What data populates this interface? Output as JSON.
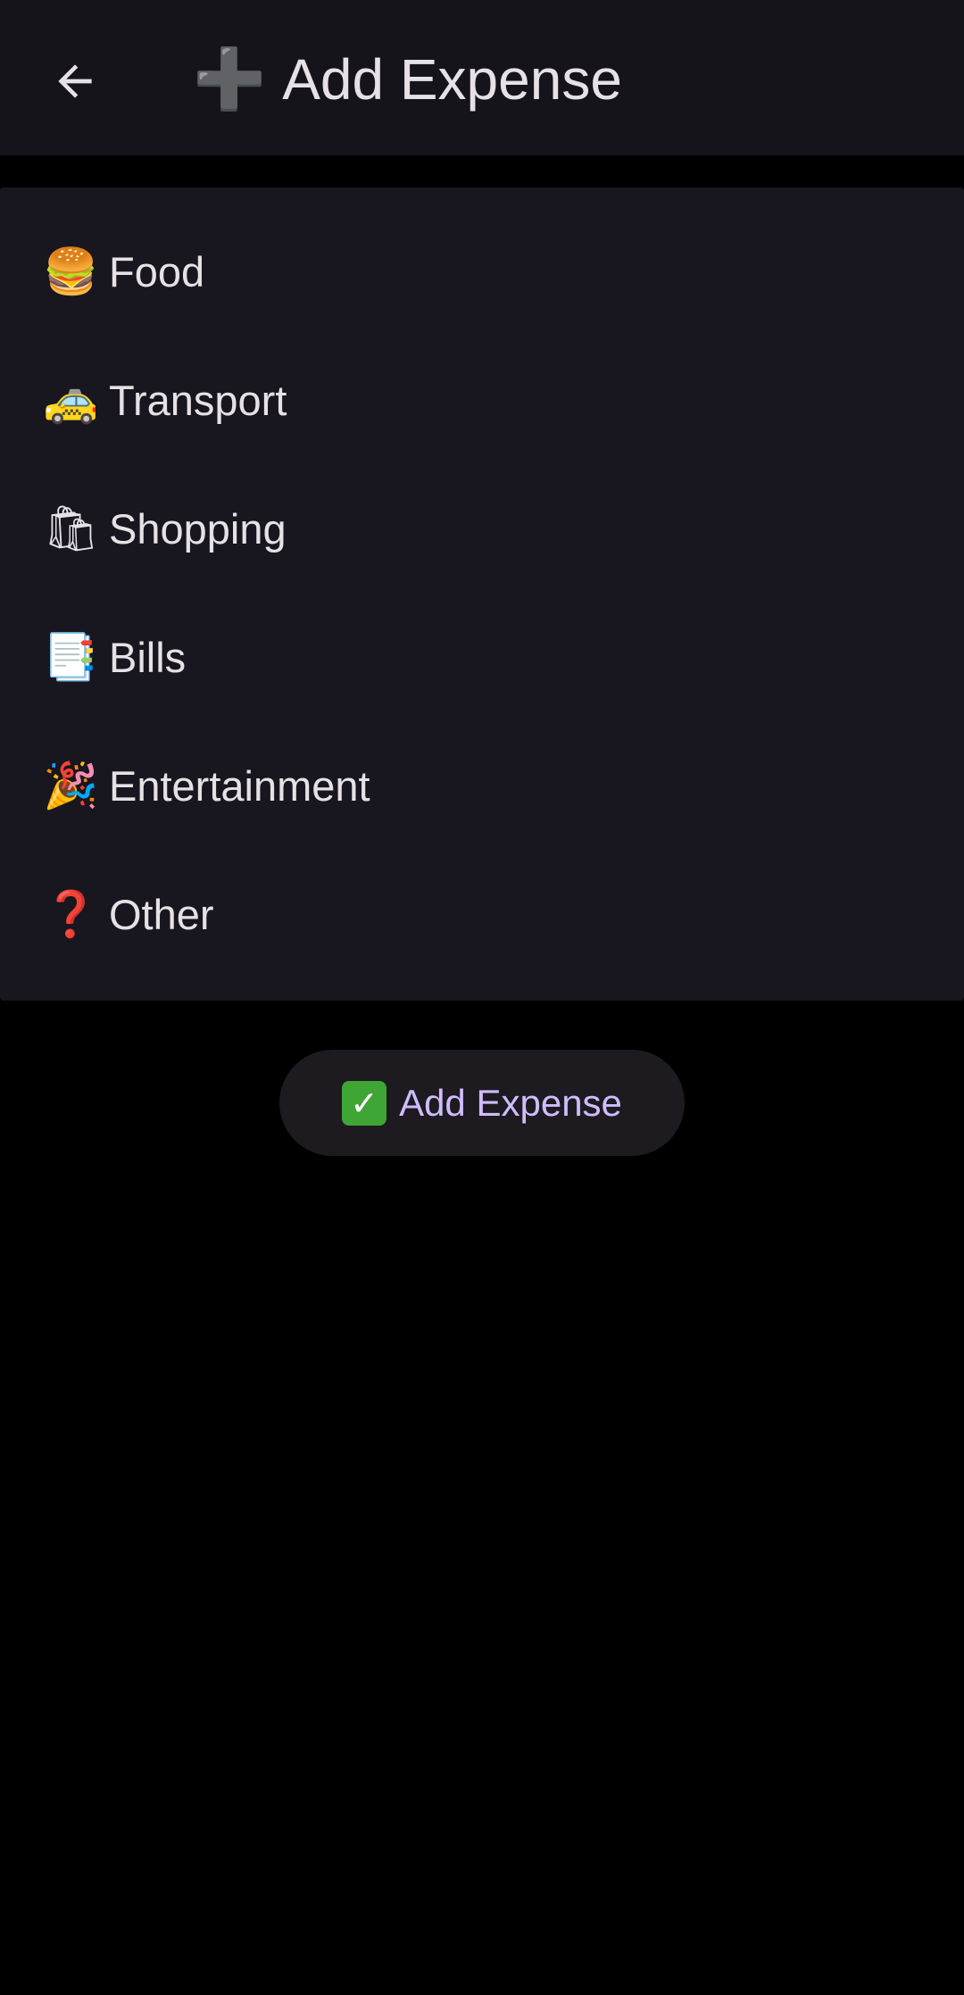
{
  "app_bar": {
    "back_icon": "arrow-left-icon",
    "title_emoji": "➕",
    "title": "Add Expense"
  },
  "categories": [
    {
      "icon": "🍔",
      "icon_name": "burger-icon",
      "label": "Food"
    },
    {
      "icon": "🚕",
      "icon_name": "taxi-icon",
      "label": "Transport"
    },
    {
      "icon": "🛍",
      "icon_name": "shopping-bags-icon",
      "label": "Shopping"
    },
    {
      "icon": "📑",
      "icon_name": "bookmark-tabs-icon",
      "label": "Bills"
    },
    {
      "icon": "🎉",
      "icon_name": "party-popper-icon",
      "label": "Entertainment"
    },
    {
      "icon": "❓",
      "icon_name": "question-mark-icon",
      "label": "Other"
    }
  ],
  "submit_button": {
    "icon": "✓",
    "icon_name": "check-mark-icon",
    "label": "Add Expense"
  },
  "colors": {
    "background": "#000000",
    "surface": "#18161E",
    "app_bar": "#16141B",
    "button_surface": "#1D1B20",
    "accent": "#D0BCFF",
    "text": "#E6E1E5",
    "check_green": "#3FA535"
  }
}
